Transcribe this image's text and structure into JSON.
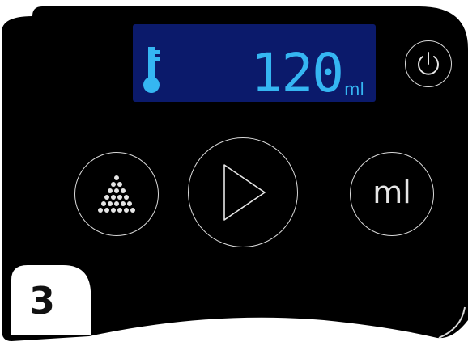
{
  "display": {
    "value": "120",
    "unit": "ml",
    "indicator_icon": "thermometer-icon",
    "background_color": "#0b1a6b",
    "digit_color": "#35b6f2"
  },
  "buttons": {
    "power": {
      "icon": "power-icon"
    },
    "portion": {
      "icon": "portion-icon"
    },
    "start": {
      "icon": "play-icon"
    },
    "ml": {
      "label": "ml"
    }
  },
  "step": {
    "number": "3"
  },
  "colors": {
    "panel": "#000000",
    "button_outline": "#d9d9d9",
    "page": "#ffffff"
  }
}
